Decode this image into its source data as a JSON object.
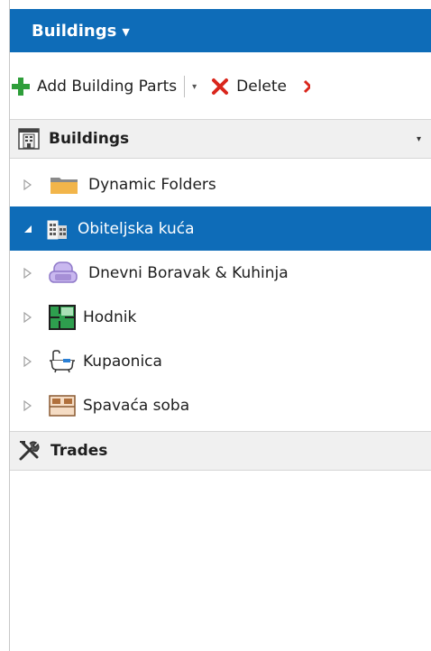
{
  "header": {
    "title": "Buildings",
    "caret": "▼"
  },
  "toolbar": {
    "add_label": "Add Building Parts",
    "delete_label": "Delete",
    "dropdown_glyph": "▾"
  },
  "buildings_section": {
    "title": "Buildings",
    "caret": "▾"
  },
  "tree": {
    "items": [
      {
        "label": "Dynamic Folders",
        "icon": "folder-icon",
        "expanded": false,
        "selected": false,
        "level": 0
      },
      {
        "label": "Obiteljska kuća",
        "icon": "building-icon",
        "expanded": true,
        "selected": true,
        "level": 0
      },
      {
        "label": "Dnevni Boravak & Kuhinja",
        "icon": "armchair-icon",
        "expanded": false,
        "selected": false,
        "level": 1
      },
      {
        "label": "Hodnik",
        "icon": "floor-plan-icon",
        "expanded": false,
        "selected": false,
        "level": 1
      },
      {
        "label": "Kupaonica",
        "icon": "bathtub-icon",
        "expanded": false,
        "selected": false,
        "level": 1
      },
      {
        "label": "Spavaća soba",
        "icon": "bed-icon",
        "expanded": false,
        "selected": false,
        "level": 1
      }
    ]
  },
  "trades_section": {
    "title": "Trades"
  },
  "colors": {
    "accent": "#0e6cb8",
    "add_green": "#2e9e3a",
    "delete_red": "#d9261c",
    "folder_orange": "#f2b54a",
    "armchair_purple": "#a68fd6",
    "plan_green": "#2e9e4e",
    "bed_brown": "#b0703c"
  }
}
